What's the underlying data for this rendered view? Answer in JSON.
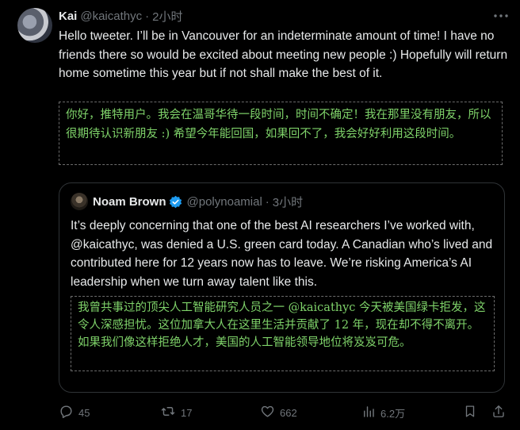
{
  "tweet": {
    "author_name": "Kai",
    "author_handle": "@kaicathyc",
    "separator": "·",
    "time": "2小时",
    "text": "Hello tweeter. I’ll be in Vancouver for an indeterminate amount of time! I have no friends there so would be excited about meeting new people :) Hopefully will return home sometime this year but if not shall make the best of it.",
    "translation": "你好，推特用户。我会在温哥华待一段时间，时间不确定！我在那里没有朋友，所以很期待认识新朋友 :) 希望今年能回国，如果回不了，我会好好利用这段时间。"
  },
  "quote": {
    "author_name": "Noam Brown",
    "author_handle": "@polynoamial",
    "separator": "·",
    "time": "3小时",
    "text": "It’s deeply concerning that one of the best AI researchers I’ve worked with, @kaicathyc, was denied a U.S. green card today. A Canadian who’s lived and contributed here for 12 years now has to leave. We’re risking America’s AI leadership when we turn away talent like this.",
    "translation": "我曾共事过的顶尖人工智能研究人员之一 @kaicathyc 今天被美国绿卡拒发，这令人深感担忧。这位加拿大人在这里生活并贡献了 12 年，现在却不得不离开。如果我们像这样拒绝人才，美国的人工智能领导地位将岌岌可危。"
  },
  "actions": {
    "replies": "45",
    "retweets": "17",
    "likes": "662",
    "views": "6.2万"
  },
  "colors": {
    "background": "#000000",
    "text": "#e7e9ea",
    "muted": "#71767b",
    "translation": "#7fd36a",
    "verified": "#1d9bf0"
  }
}
